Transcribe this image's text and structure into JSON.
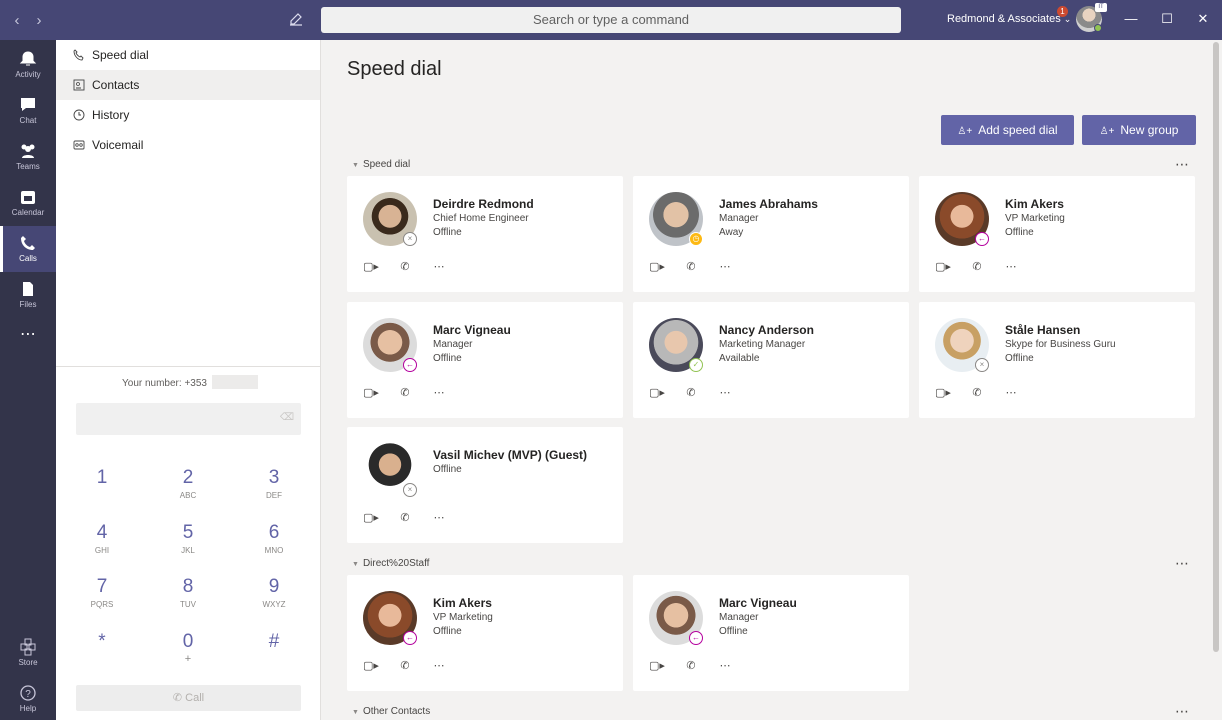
{
  "topbar": {
    "search_placeholder": "Search or type a command",
    "org": "Redmond & Associates",
    "notif_count": "1",
    "me_tag": "IT"
  },
  "rail": [
    {
      "label": "Activity",
      "icon": "bell-icon"
    },
    {
      "label": "Chat",
      "icon": "chat-icon"
    },
    {
      "label": "Teams",
      "icon": "teams-icon"
    },
    {
      "label": "Calendar",
      "icon": "calendar-icon"
    },
    {
      "label": "Calls",
      "icon": "phone-icon"
    },
    {
      "label": "Files",
      "icon": "file-icon"
    },
    {
      "label": "",
      "icon": "more-icon"
    },
    {
      "label": "Store",
      "icon": "store-icon"
    },
    {
      "label": "Help",
      "icon": "help-icon"
    }
  ],
  "left_nav": [
    {
      "label": "Speed dial",
      "icon": "phone-icon"
    },
    {
      "label": "Contacts",
      "icon": "contacts-icon"
    },
    {
      "label": "History",
      "icon": "clock-icon"
    },
    {
      "label": "Voicemail",
      "icon": "voicemail-icon"
    }
  ],
  "dialpad": {
    "your_number": "Your number: +353",
    "keys": [
      {
        "d": "1",
        "l": ""
      },
      {
        "d": "2",
        "l": "ABC"
      },
      {
        "d": "3",
        "l": "DEF"
      },
      {
        "d": "4",
        "l": "GHI"
      },
      {
        "d": "5",
        "l": "JKL"
      },
      {
        "d": "6",
        "l": "MNO"
      },
      {
        "d": "7",
        "l": "PQRS"
      },
      {
        "d": "8",
        "l": "TUV"
      },
      {
        "d": "9",
        "l": "WXYZ"
      },
      {
        "d": "*",
        "l": ""
      },
      {
        "d": "0",
        "l": "+"
      },
      {
        "d": "#",
        "l": ""
      }
    ],
    "call_label": "Call"
  },
  "main": {
    "title": "Speed dial",
    "add_speed_dial": "Add speed dial",
    "new_group": "New group",
    "sections": [
      {
        "label": "Speed dial"
      },
      {
        "label": "Direct%20Staff"
      },
      {
        "label": "Other Contacts"
      }
    ],
    "speed_dial": [
      {
        "name": "Deirdre Redmond",
        "role": "Chief Home Engineer",
        "status": "Offline"
      },
      {
        "name": "James Abrahams",
        "role": "Manager",
        "status": "Away"
      },
      {
        "name": "Kim Akers",
        "role": "VP Marketing",
        "status": "Offline"
      },
      {
        "name": "Marc Vigneau",
        "role": "Manager",
        "status": "Offline"
      },
      {
        "name": "Nancy Anderson",
        "role": "Marketing Manager",
        "status": "Available"
      },
      {
        "name": "Ståle Hansen",
        "role": "Skype for Business Guru",
        "status": "Offline"
      },
      {
        "name": "Vasil Michev (MVP) (Guest)",
        "role": "",
        "status": "Offline"
      }
    ],
    "direct_staff": [
      {
        "name": "Kim Akers",
        "role": "VP Marketing",
        "status": "Offline"
      },
      {
        "name": "Marc Vigneau",
        "role": "Manager",
        "status": "Offline"
      }
    ]
  }
}
